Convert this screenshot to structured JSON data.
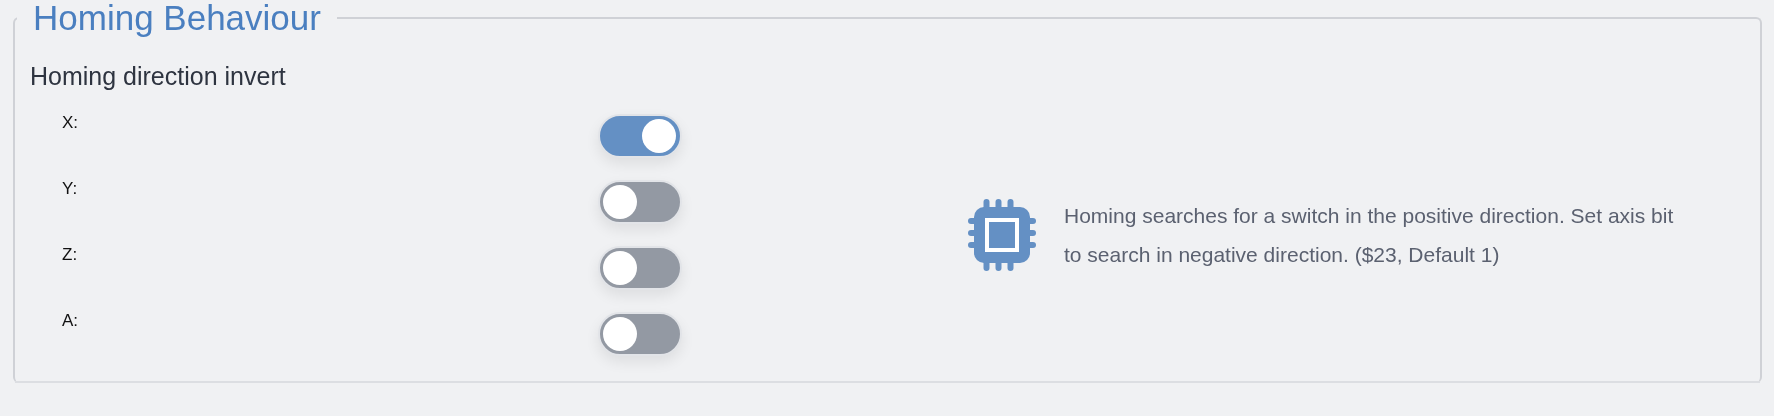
{
  "section": {
    "title": "Homing Behaviour"
  },
  "setting": {
    "label": "Homing direction invert",
    "axes": [
      {
        "label": "X:",
        "on": true
      },
      {
        "label": "Y:",
        "on": false
      },
      {
        "label": "Z:",
        "on": false
      },
      {
        "label": "A:",
        "on": false
      }
    ],
    "description": "Homing searches for a switch in the positive direction. Set axis bit to search in negative direction. ($23, Default 1)"
  }
}
